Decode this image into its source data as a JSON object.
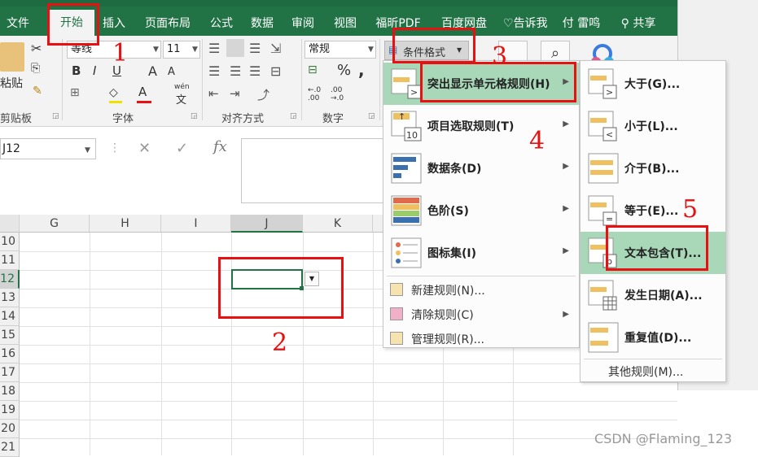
{
  "tabs": [
    {
      "label": "文件"
    },
    {
      "label": "开始"
    },
    {
      "label": "插入"
    },
    {
      "label": "页面布局"
    },
    {
      "label": "公式"
    },
    {
      "label": "数据"
    },
    {
      "label": "审阅"
    },
    {
      "label": "视图"
    },
    {
      "label": "福昕PDF"
    },
    {
      "label": "百度网盘"
    }
  ],
  "tell_me": "告诉我",
  "user": "付 雷鸣",
  "share": "共享",
  "ribbon": {
    "paste": "粘贴",
    "font_name": "等线",
    "font_size": "11",
    "number_format": "常规",
    "cf_button": "条件格式",
    "percent": "%",
    "comma": ",",
    "groups": {
      "clipboard": "剪贴板",
      "font": "字体",
      "align": "对齐方式",
      "number": "数字"
    },
    "bold": "B",
    "italic": "I",
    "underline": "U",
    "grow_font": "A",
    "shrink_font": "A",
    "font_color": "A",
    "wen": "wén",
    "wen2": "文",
    "dec_inc": "←.0 .00",
    "dec_dec": ".00 →.0"
  },
  "namebox": "J12",
  "fx": "fx",
  "columns": [
    "G",
    "H",
    "I",
    "J",
    "K"
  ],
  "rows": [
    "10",
    "11",
    "12",
    "13",
    "14",
    "15",
    "16",
    "17",
    "18",
    "19",
    "20",
    "21"
  ],
  "cf_menu": {
    "items": [
      {
        "label": "突出显示单元格规则(H)"
      },
      {
        "label": "项目选取规则(T)"
      },
      {
        "label": "数据条(D)"
      },
      {
        "label": "色阶(S)"
      },
      {
        "label": "图标集(I)"
      }
    ],
    "small": [
      {
        "label": "新建规则(N)..."
      },
      {
        "label": "清除规则(C)"
      },
      {
        "label": "管理规则(R)..."
      }
    ]
  },
  "submenu": {
    "items": [
      {
        "label": "大于(G)..."
      },
      {
        "label": "小于(L)..."
      },
      {
        "label": "介于(B)..."
      },
      {
        "label": "等于(E)..."
      },
      {
        "label": "文本包含(T)..."
      },
      {
        "label": "发生日期(A)..."
      },
      {
        "label": "重复值(D)..."
      }
    ],
    "other": "其他规则(M)..."
  },
  "annotations": {
    "n1": "1",
    "n2": "2",
    "n3": "3",
    "n4": "4",
    "n5": "5"
  },
  "watermark": "CSDN @Flaming_123",
  "colors": {
    "excel_green": "#217346",
    "highlight": "#a8d8b8",
    "annotation_red": "#e81010"
  }
}
